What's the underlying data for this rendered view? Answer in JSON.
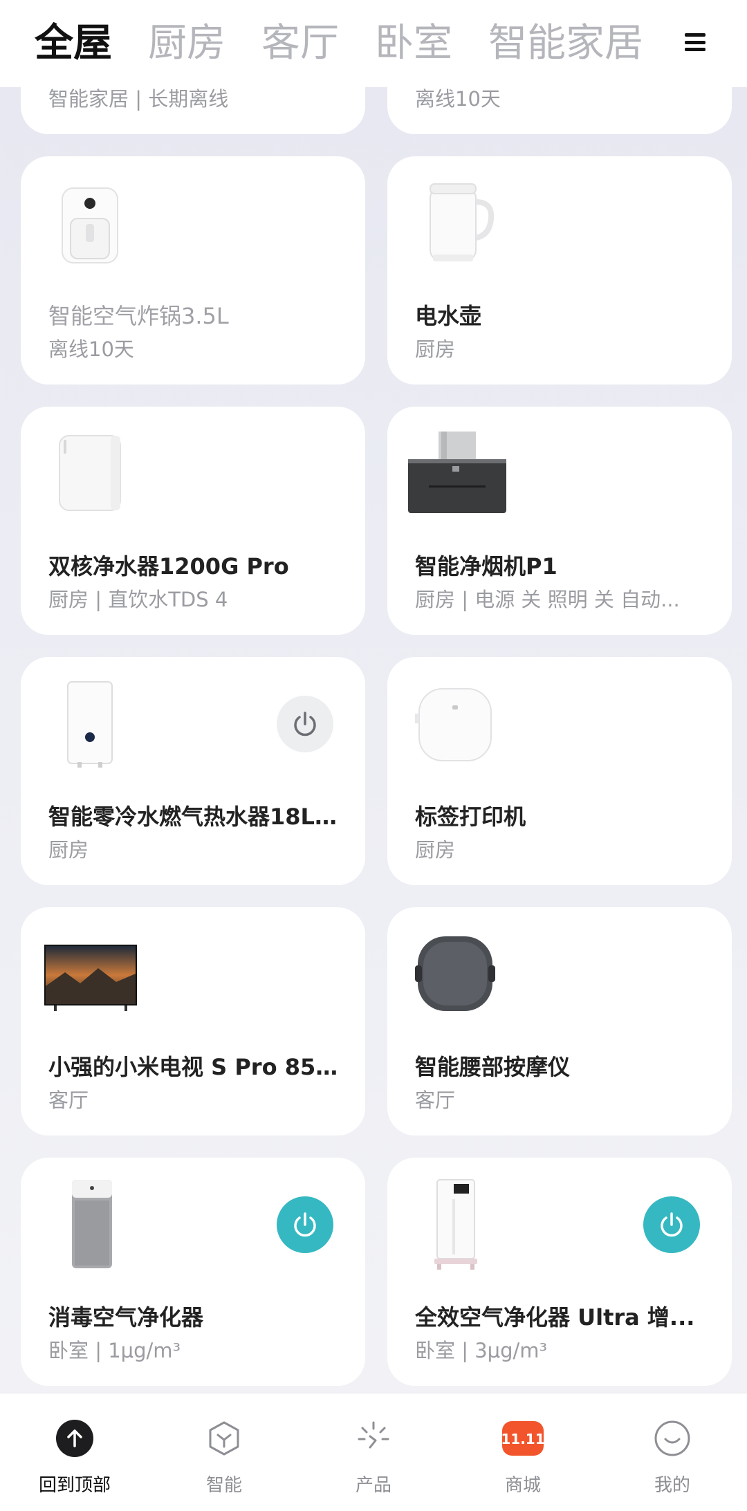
{
  "tabs": [
    "全屋",
    "厨房",
    "客厅",
    "卧室",
    "智能家居"
  ],
  "partial_cards": {
    "left_sub": "智能家居 | 长期离线",
    "right_sub": "离线10天"
  },
  "devices": [
    {
      "name": "智能空气炸锅3.5L",
      "sub": "离线10天",
      "offline": true,
      "icon": "air-fryer-icon"
    },
    {
      "name": "电水壶",
      "sub": "厨房",
      "icon": "kettle-icon"
    },
    {
      "name": "双核净水器1200G Pro",
      "sub": "厨房 | 直饮水TDS 4",
      "icon": "water-purifier-icon"
    },
    {
      "name": "智能净烟机P1",
      "sub": "厨房 | 电源 关 照明 关 自动...",
      "icon": "range-hood-icon"
    },
    {
      "name": "智能零冷水燃气热水器18L...",
      "sub": "厨房",
      "icon": "water-heater-icon",
      "power": "off"
    },
    {
      "name": "标签打印机",
      "sub": "厨房",
      "icon": "label-printer-icon"
    },
    {
      "name": "小强的小米电视 S Pro 85...",
      "sub": "客厅",
      "icon": "tv-icon"
    },
    {
      "name": "智能腰部按摩仪",
      "sub": "客厅",
      "icon": "massager-icon"
    },
    {
      "name": "消毒空气净化器",
      "sub": "卧室 | 1μg/m³",
      "icon": "air-purifier-icon",
      "power": "on"
    },
    {
      "name": "全效空气净化器 Ultra 增...",
      "sub": "卧室 | 3μg/m³",
      "icon": "air-purifier-tall-icon",
      "power": "on"
    }
  ],
  "bottom_nav": [
    {
      "label": "回到顶部",
      "icon": "arrow-up-icon"
    },
    {
      "label": "智能",
      "icon": "smart-hexagon-icon"
    },
    {
      "label": "产品",
      "icon": "product-sparkle-icon"
    },
    {
      "label": "商城",
      "icon": "mall-badge-icon",
      "badge": "11.11"
    },
    {
      "label": "我的",
      "icon": "profile-smile-icon"
    }
  ],
  "colors": {
    "power_on": "#35b8c2",
    "power_off_bg": "#eceef0",
    "mall_badge": "#f2552c"
  }
}
